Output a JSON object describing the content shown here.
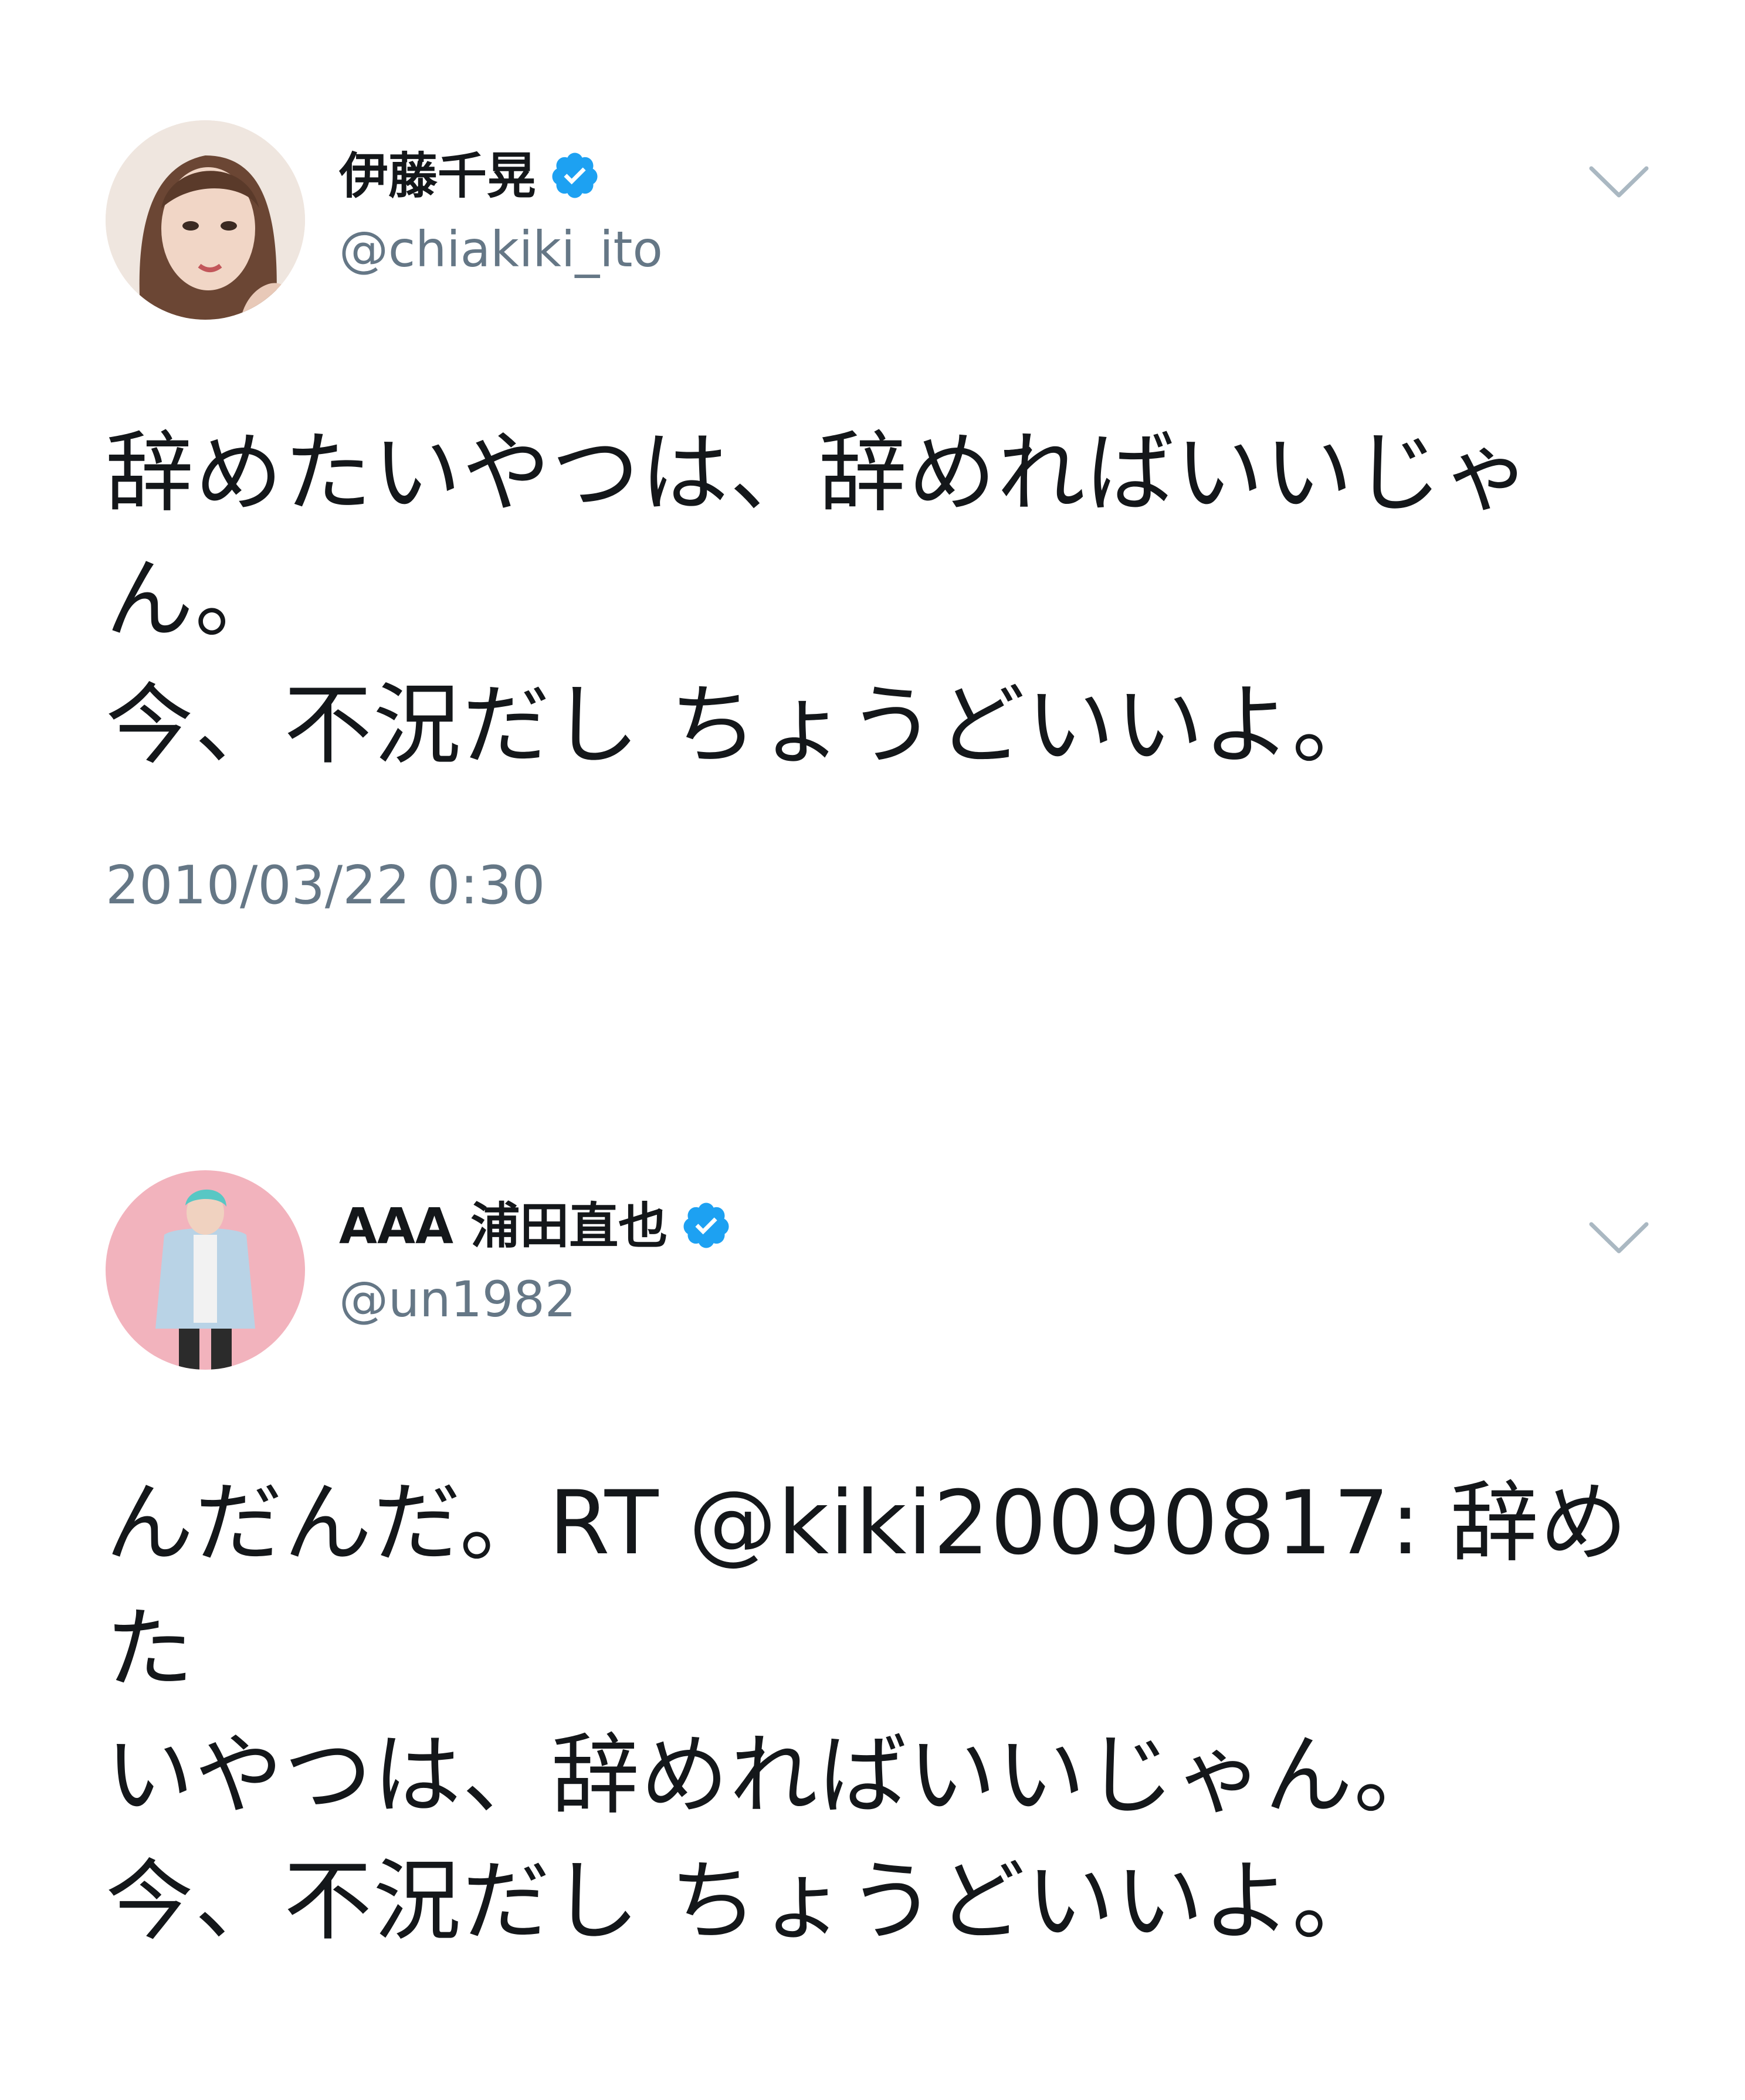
{
  "tweets": [
    {
      "display_name": "伊藤千晃",
      "handle": "@chiakiki_ito",
      "verified": true,
      "text": "辞めたいやつは、辞めればいいじゃ\nん。\n今、不況だし ちょうどいいよ。",
      "timestamp": "2010/03/22 0:30"
    },
    {
      "display_name": "AAA 浦田直也",
      "handle": "@un1982",
      "verified": true,
      "text": "んだんだ。RT @kiki20090817: 辞めた\nいやつは、辞めればいいじゃん。\n今、不況だし ちょうどいいよ。"
    }
  ],
  "colors": {
    "text": "#14171a",
    "secondary": "#657786",
    "verified": "#1da1f2",
    "caret": "#aab8c2"
  }
}
